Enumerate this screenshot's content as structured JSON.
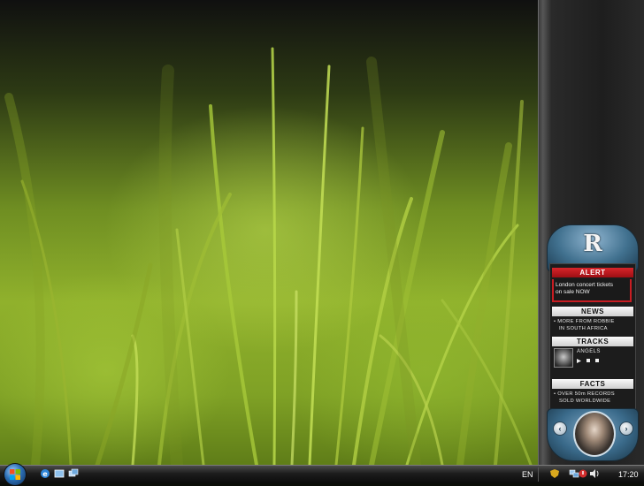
{
  "gadget": {
    "alert": {
      "title": "ALERT",
      "line1": "London concert tickets",
      "line2": "on sale NOW"
    },
    "news": {
      "title": "NEWS",
      "line1": "• MORE FROM ROBBIE",
      "line2": "IN SOUTH AFRICA"
    },
    "tracks": {
      "title": "TRACKS",
      "song": "ANGELS"
    },
    "facts": {
      "title": "FACTS",
      "line1": "• OVER 50m RECORDS",
      "line2": "SOLD WORLDWIDE"
    }
  },
  "taskbar": {
    "language": "EN",
    "clock": "17:20"
  },
  "colors": {
    "alert_red": "#c81d22",
    "gadget_blue": "#41718f"
  }
}
